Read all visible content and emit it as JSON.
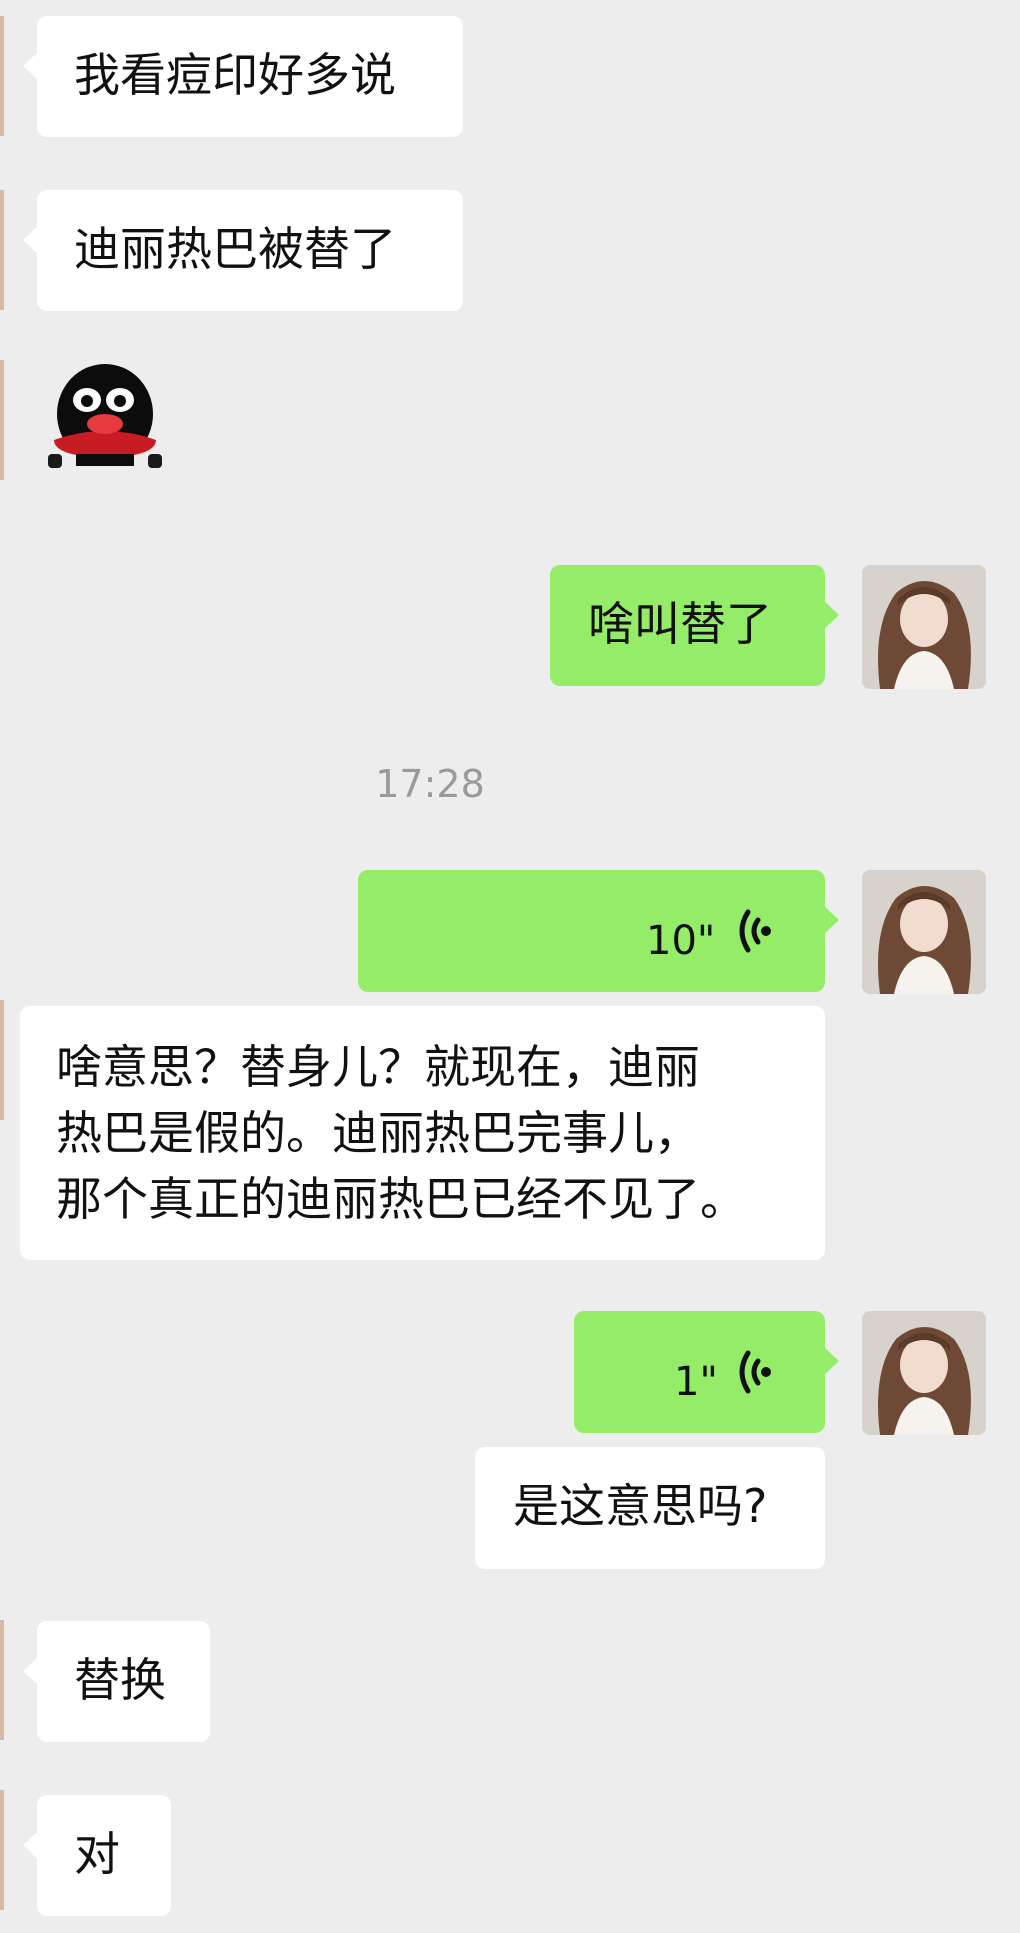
{
  "messages": [
    {
      "id": "m1",
      "side": "in",
      "text": "我看痘印好多说"
    },
    {
      "id": "m2",
      "side": "in",
      "text": "迪丽热巴被替了"
    },
    {
      "id": "m3",
      "side": "in",
      "type": "sticker",
      "icon": "penguin-sticker-icon"
    },
    {
      "id": "m4",
      "side": "out",
      "text": "啥叫替了"
    },
    {
      "id": "m5",
      "side": "out",
      "type": "voice",
      "duration": "10\"",
      "icon": "voice-wave-icon"
    },
    {
      "id": "m6",
      "side": "in",
      "lines": [
        "啥意思？替身儿？就现在，迪丽",
        "热巴是假的。迪丽热巴完事儿，",
        "那个真正的迪丽热巴已经不见了。"
      ]
    },
    {
      "id": "m7",
      "side": "out",
      "type": "voice",
      "duration": "1\"",
      "icon": "voice-wave-icon"
    },
    {
      "id": "m8",
      "side": "out",
      "text": "是这意思吗?"
    },
    {
      "id": "m9",
      "side": "in",
      "text": "替换"
    },
    {
      "id": "m10",
      "side": "in",
      "text": "对"
    }
  ],
  "timestamp": "17:28",
  "colors": {
    "background": "#ededed",
    "incoming_bubble": "#ffffff",
    "outgoing_bubble": "#95ec69",
    "timestamp_text": "#9a9a9a"
  }
}
